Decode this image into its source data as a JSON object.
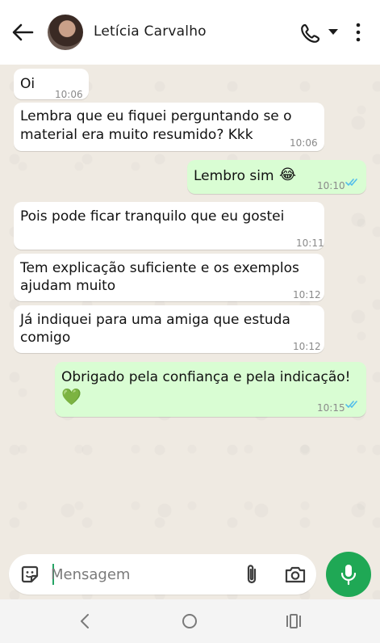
{
  "header": {
    "contact_name": "Letícia Carvalho",
    "icons": [
      "back-arrow-icon",
      "avatar",
      "phone-icon",
      "chevron-down-icon",
      "more-vert-icon"
    ]
  },
  "messages": [
    {
      "direction": "in",
      "text_lines": [
        "Oi"
      ],
      "time": "10:06"
    },
    {
      "direction": "in",
      "text_lines": [
        "Lembra que eu fiquei perguntando se o",
        "material era muito resumido? Kkk"
      ],
      "time": "10:06"
    },
    {
      "direction": "out",
      "text_lines": [
        "Lembro sim"
      ],
      "emoji": "😂",
      "time": "10:10",
      "status": "read"
    },
    {
      "direction": "in",
      "text_lines": [
        "Pois pode ficar tranquilo que eu gostei"
      ],
      "time": "10:11"
    },
    {
      "direction": "in",
      "text_lines": [
        "Tem explicação suficiente e os exemplos",
        "ajudam muito"
      ],
      "time": "10:12"
    },
    {
      "direction": "in",
      "text_lines": [
        "Já indiquei para uma amiga que estuda",
        "comigo"
      ],
      "time": "10:12"
    },
    {
      "direction": "out",
      "text_lines": [
        "Obrigado pela confiança e pela indicação!"
      ],
      "emoji": "💚",
      "time": "10:15",
      "status": "read"
    }
  ],
  "composer": {
    "placeholder": "Mensagem",
    "value": ""
  },
  "colors": {
    "chat_bg": "#efeae2",
    "incoming_bubble": "#ffffff",
    "outgoing_bubble": "#d9fdd3",
    "accent_green": "#1fa855",
    "read_ticks": "#53bdeb"
  }
}
